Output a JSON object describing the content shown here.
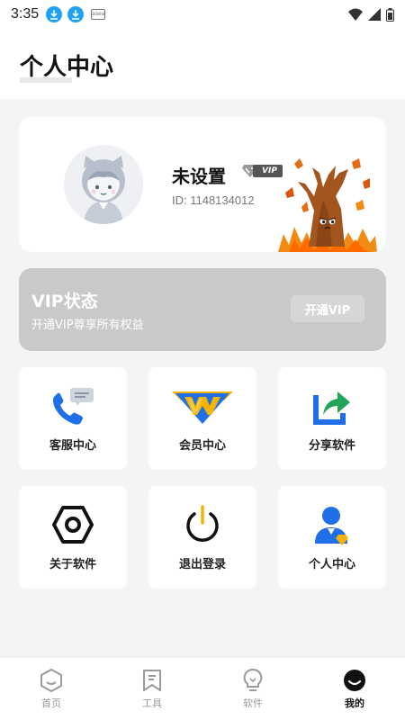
{
  "status_bar": {
    "time": "3:35",
    "icons": [
      "download-icon",
      "download-icon",
      "app-notification-icon",
      "wifi-icon",
      "signal-icon",
      "battery-icon"
    ],
    "small_badge": "asea"
  },
  "header": {
    "title": "个人中心"
  },
  "profile": {
    "username": "未设置",
    "vip_badge": "VIP",
    "id_text": "ID: 1148134012"
  },
  "vip_banner": {
    "title": "VIP状态",
    "subtitle": "开通VIP尊享所有权益",
    "button": "开通VIP"
  },
  "menu": [
    {
      "label": "客服中心",
      "icon": "customer-service-icon"
    },
    {
      "label": "会员中心",
      "icon": "vip-crown-icon"
    },
    {
      "label": "分享软件",
      "icon": "share-icon"
    },
    {
      "label": "关于软件",
      "icon": "hexagon-nut-icon"
    },
    {
      "label": "退出登录",
      "icon": "power-icon"
    },
    {
      "label": "个人中心",
      "icon": "user-profile-icon"
    }
  ],
  "bottom_nav": [
    {
      "label": "首页",
      "icon": "home-hexagon-icon",
      "active": false
    },
    {
      "label": "工具",
      "icon": "bookmark-icon",
      "active": false
    },
    {
      "label": "软件",
      "icon": "lightbulb-icon",
      "active": false
    },
    {
      "label": "我的",
      "icon": "smiley-icon",
      "active": true
    }
  ],
  "colors": {
    "accent_blue": "#1e6fe8",
    "vip_gold": "#f5b400",
    "vip_banner_bg": "#c9c9c9",
    "page_bg": "#f4f4f4"
  }
}
